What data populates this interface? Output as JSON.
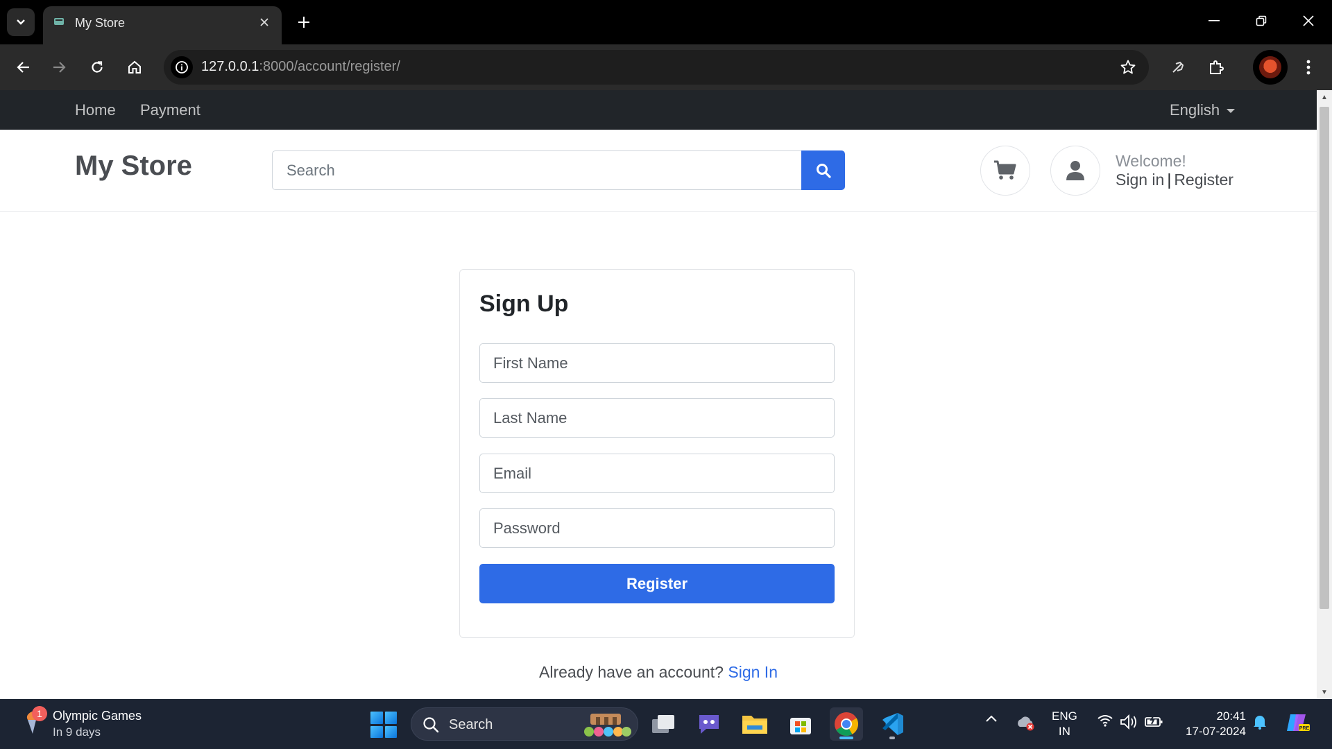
{
  "browser": {
    "tab_title": "My Store",
    "url_host": "127.0.0.1",
    "url_rest": ":8000/account/register/"
  },
  "site": {
    "nav": {
      "home": "Home",
      "payment": "Payment",
      "language": "English"
    },
    "brand": "My Store",
    "search_placeholder": "Search",
    "welcome": "Welcome!",
    "sign_in": "Sign in",
    "separator": "|",
    "register": "Register"
  },
  "form": {
    "title": "Sign Up",
    "first_name_placeholder": "First Name",
    "last_name_placeholder": "Last Name",
    "email_placeholder": "Email",
    "password_placeholder": "Password",
    "submit_label": "Register",
    "footer_text": "Already have an account?",
    "footer_link": "Sign In"
  },
  "taskbar": {
    "news_badge": "1",
    "news_title": "Olympic Games",
    "news_subtitle": "In 9 days",
    "search_label": "Search",
    "lang_top": "ENG",
    "lang_bottom": "IN",
    "time": "20:41",
    "date": "17-07-2024"
  },
  "colors": {
    "accent": "#2e6be6",
    "navbar": "#212529",
    "taskbar": "#1c2433"
  }
}
